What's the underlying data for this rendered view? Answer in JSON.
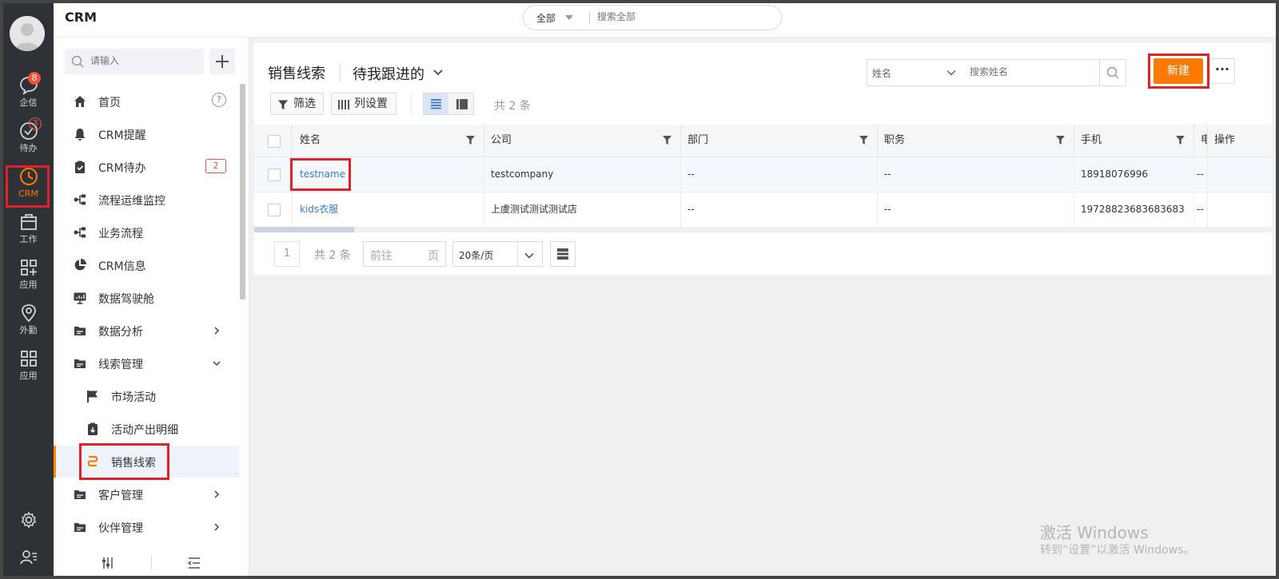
{
  "header": {
    "app_title": "CRM"
  },
  "global_search": {
    "scope": "全部",
    "placeholder": "搜索全部"
  },
  "rail": {
    "items": [
      {
        "label": "企信",
        "badge": "8"
      },
      {
        "label": "待办",
        "badge": "3"
      },
      {
        "label": "CRM"
      },
      {
        "label": "工作"
      },
      {
        "label": "应用"
      },
      {
        "label": "外勤"
      },
      {
        "label": "应用"
      }
    ]
  },
  "sidebar": {
    "search_placeholder": "请输入",
    "items": [
      {
        "label": "首页",
        "help": "?"
      },
      {
        "label": "CRM提醒"
      },
      {
        "label": "CRM待办",
        "badge": "2"
      },
      {
        "label": "流程运维监控"
      },
      {
        "label": "业务流程"
      },
      {
        "label": "CRM信息"
      },
      {
        "label": "数据驾驶舱"
      },
      {
        "label": "数据分析"
      },
      {
        "label": "线索管理"
      },
      {
        "label": "市场活动"
      },
      {
        "label": "活动产出明细"
      },
      {
        "label": "销售线索"
      },
      {
        "label": "客户管理"
      },
      {
        "label": "伙伴管理"
      }
    ]
  },
  "main": {
    "title": "销售线索",
    "view": "待我跟进的",
    "field_selector": {
      "label": "姓名",
      "placeholder": "搜索姓名"
    },
    "new_button": "新建",
    "more_button": "···",
    "filter_button": "筛选",
    "columns_button": "列设置",
    "total": "共 2 条"
  },
  "table": {
    "columns": [
      "姓名",
      "公司",
      "部门",
      "职务",
      "手机",
      "电",
      "操作"
    ],
    "rows": [
      {
        "name": "testname",
        "company": "testcompany",
        "dept": "--",
        "title": "--",
        "mobile": "18918076996",
        "tel": "--"
      },
      {
        "name": "kids衣服",
        "company": "上虞测试测试测试店",
        "dept": "--",
        "title": "--",
        "mobile": "19728823683683683",
        "tel": "--"
      }
    ]
  },
  "pagination": {
    "current": "1",
    "total": "共 2 条",
    "goto_prefix": "前往",
    "goto_suffix": "页",
    "page_size": "20条/页"
  },
  "watermark": {
    "line1": "激活 Windows",
    "line2": "转到“设置”以激活 Windows。"
  },
  "colors": {
    "accent": "#ff7a00",
    "link": "#3b7bd0",
    "highlight_box": "#e0202a",
    "rail_bg": "#2e3237"
  }
}
